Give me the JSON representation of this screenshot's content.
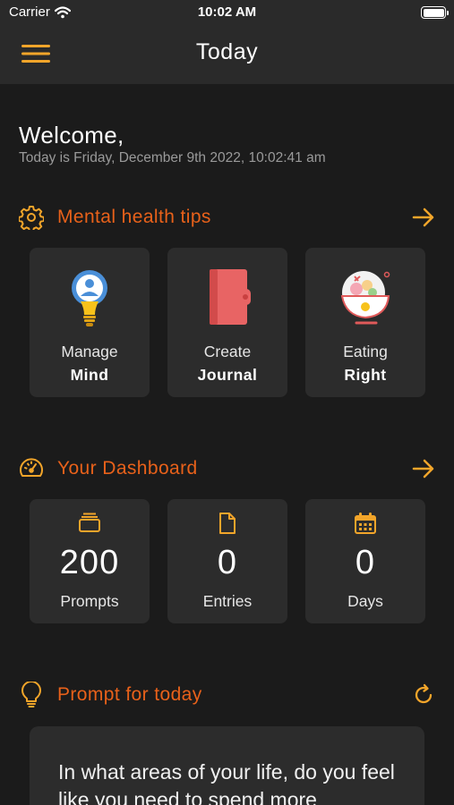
{
  "status_bar": {
    "carrier": "Carrier",
    "time": "10:02 AM"
  },
  "nav": {
    "title": "Today",
    "menu_icon": "hamburger-menu-icon"
  },
  "welcome": {
    "heading": "Welcome,",
    "date_line": "Today is Friday, December 9th 2022, 10:02:41 am"
  },
  "sections": {
    "tips": {
      "title": "Mental health tips",
      "icon": "gear-icon",
      "action_icon": "arrow-right-icon"
    },
    "dashboard": {
      "title": "Your Dashboard",
      "icon": "speedometer-icon",
      "action_icon": "arrow-right-icon"
    },
    "prompt": {
      "title": "Prompt for today",
      "icon": "lightbulb-icon",
      "action_icon": "refresh-icon"
    }
  },
  "tips": [
    {
      "line1": "Manage",
      "line2": "Mind",
      "icon": "lightbulb-head-icon"
    },
    {
      "line1": "Create",
      "line2": "Journal",
      "icon": "journal-book-icon"
    },
    {
      "line1": "Eating",
      "line2": "Right",
      "icon": "food-bowl-icon"
    }
  ],
  "dashboard": [
    {
      "value": "200",
      "label": "Prompts",
      "icon": "stack-icon"
    },
    {
      "value": "0",
      "label": "Entries",
      "icon": "document-icon"
    },
    {
      "value": "0",
      "label": "Days",
      "icon": "calendar-icon"
    }
  ],
  "prompt": {
    "text": "In what areas of your life, do you feel like you need to spend more"
  },
  "colors": {
    "accent": "#e8611a",
    "icon_yellow": "#f2a52a",
    "background": "#1b1b1b",
    "card": "#2c2c2c",
    "topbar": "#2a2a2a"
  }
}
